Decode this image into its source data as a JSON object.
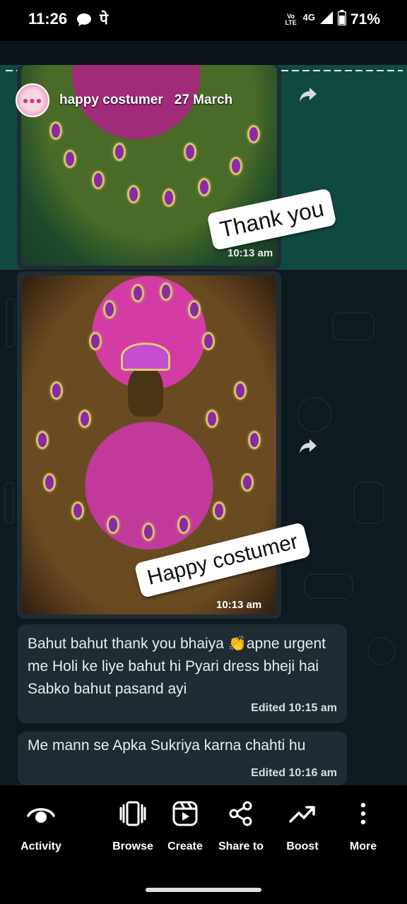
{
  "status_bar": {
    "time": "11:26",
    "chat_icon": "chat-bubble-icon",
    "notification_text": "पे",
    "volte_label": "Vo LTE",
    "network": "4G",
    "battery": "71%"
  },
  "story": {
    "caption": {
      "name": "happy costumer",
      "date": "27 March"
    },
    "image_message_1": {
      "sticker": "Thank you",
      "time": "10:13 am"
    },
    "image_message_2": {
      "sticker": "Happy costumer",
      "time": "10:13 am"
    },
    "messages": [
      {
        "text": "Bahut bahut thank you bhaiya 👏apne urgent me Holi ke liye bahut hi Pyari dress bheji hai Sabko bahut pasand ayi",
        "meta": "Edited 10:15 am"
      },
      {
        "text": "Me mann se Apka Sukriya karna chahti hu",
        "meta": "Edited 10:16 am"
      }
    ]
  },
  "toolbar": {
    "items": [
      {
        "label": "Activity",
        "icon": "eye-icon"
      },
      {
        "label": "Browse",
        "icon": "phone-stack-icon"
      },
      {
        "label": "Create",
        "icon": "reel-create-icon"
      },
      {
        "label": "Share to",
        "icon": "share-icon"
      },
      {
        "label": "Boost",
        "icon": "trend-up-icon"
      },
      {
        "label": "More",
        "icon": "more-vertical-icon"
      }
    ]
  },
  "colors": {
    "chat_green": "#0f4a40",
    "chat_dark": "#0e1a20",
    "bubble": "#1f2c34"
  }
}
